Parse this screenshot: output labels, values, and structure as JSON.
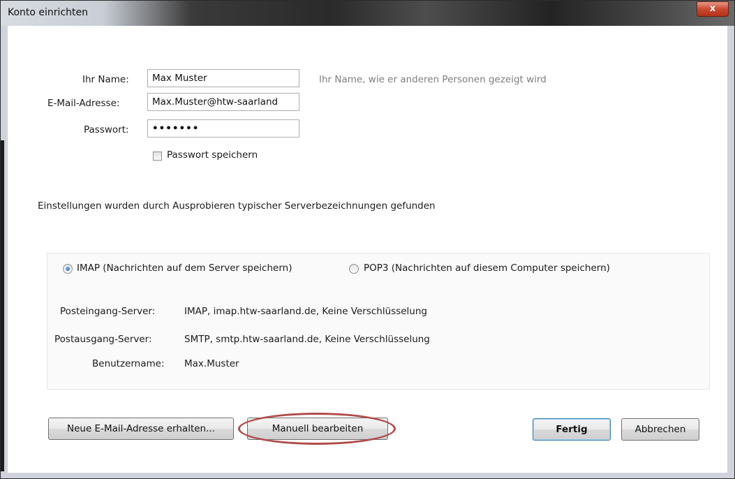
{
  "window": {
    "title": "Konto einrichten",
    "close_glyph": "x"
  },
  "form": {
    "name": {
      "label": "Ihr Name:",
      "value": "Max Muster",
      "hint": "Ihr Name, wie er anderen Personen gezeigt wird"
    },
    "email": {
      "label": "E-Mail-Adresse:",
      "value": "Max.Muster@htw-saarland"
    },
    "password": {
      "label": "Passwort:",
      "value": "•••••••"
    },
    "save_password": {
      "label": "Passwort speichern",
      "checked": false
    }
  },
  "status_text": "Einstellungen wurden durch Ausprobieren typischer Serverbezeichnungen gefunden",
  "protocol": {
    "imap_label": "IMAP (Nachrichten auf dem Server speichern)",
    "pop3_label": "POP3 (Nachrichten auf diesem Computer speichern)",
    "selected": "IMAP"
  },
  "servers": {
    "incoming_label": "Posteingang-Server:",
    "incoming_value": "IMAP, imap.htw-saarland.de, Keine Verschlüsselung",
    "outgoing_label": "Postausgang-Server:",
    "outgoing_value": "SMTP, smtp.htw-saarland.de, Keine Verschlüsselung",
    "username_label": "Benutzername:",
    "username_value": "Max.Muster"
  },
  "buttons": {
    "new_address": "Neue E-Mail-Adresse erhalten...",
    "manual_edit": "Manuell bearbeiten",
    "done": "Fertig",
    "cancel": "Abbrechen"
  },
  "colors": {
    "highlight": "#b04c4a",
    "close_button": "#c94a30"
  }
}
